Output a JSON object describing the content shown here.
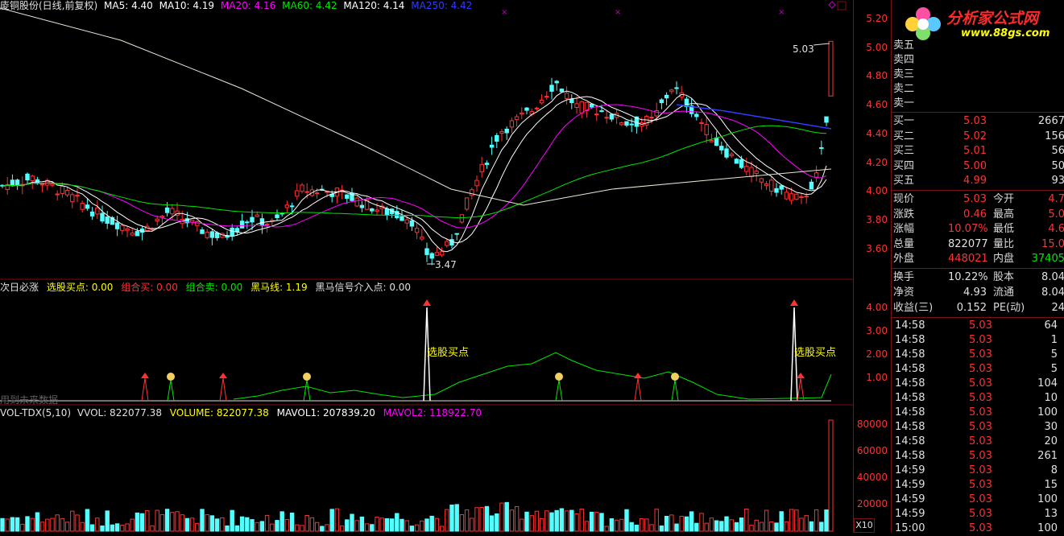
{
  "main_header": {
    "title": "庱铜股份(日线,前复权)",
    "ma5": "MA5: 4.40",
    "ma10": "MA10: 4.19",
    "ma20": "MA20: 4.16",
    "ma60": "MA60: 4.42",
    "ma120": "MA120: 4.14",
    "ma250": "MA250: 4.42"
  },
  "colors": {
    "up": "#ff3232",
    "down": "#54ffff",
    "ma5": "#ffffff",
    "ma10": "#ffff00",
    "ma20": "#ff00ff",
    "ma60": "#00e600",
    "ma250": "#2f3cff",
    "grid": "#7a1010"
  },
  "price_annotations": {
    "high_label": "5.03",
    "low_label": "3.47"
  },
  "price_axis": [
    "5.20",
    "5.00",
    "4.80",
    "4.60",
    "4.40",
    "4.20",
    "4.00",
    "3.80",
    "3.60"
  ],
  "indicator_header": {
    "name": "次日必涨",
    "buy_point": "选股买点: 0.00",
    "combo_buy": "组合买: 0.00",
    "combo_sell": "组合卖: 0.00",
    "black_horse": "黑马线: 1.19",
    "black_horse_signal": "黑马信号介入点: 0.00"
  },
  "indicator_labels": {
    "buy_point_1": "选股买点",
    "buy_point_2": "选股买点",
    "future_data": "用到未来数据"
  },
  "indicator_axis": [
    "4.00",
    "3.00",
    "2.00",
    "1.00"
  ],
  "volume_header": {
    "name": "VOL-TDX(5,10)",
    "vvol": "VVOL: 822077.38",
    "volume": "VOLUME: 822077.38",
    "mavol1": "MAVOL1: 207839.20",
    "mavol2": "MAVOL2: 118922.70"
  },
  "volume_axis": [
    "80000",
    "60000",
    "40000",
    "20000"
  ],
  "volume_unit": "X10",
  "logo": {
    "text": "分析家公式网",
    "url": "www.88gs.com"
  },
  "quote": {
    "sell": [
      {
        "label": "卖五"
      },
      {
        "label": "卖四"
      },
      {
        "label": "卖三"
      },
      {
        "label": "卖二"
      },
      {
        "label": "卖一"
      }
    ],
    "buy": [
      {
        "label": "买一",
        "price": "5.03",
        "vol": "2667"
      },
      {
        "label": "买二",
        "price": "5.02",
        "vol": "156"
      },
      {
        "label": "买三",
        "price": "5.01",
        "vol": "56"
      },
      {
        "label": "买四",
        "price": "5.00",
        "vol": "50"
      },
      {
        "label": "买五",
        "price": "4.99",
        "vol": "93"
      }
    ],
    "stats": [
      {
        "l1": "现价",
        "v1": "5.03",
        "l2": "今开",
        "v2": "4.7"
      },
      {
        "l1": "涨跌",
        "v1": "0.46",
        "l2": "最高",
        "v2": "5.0"
      },
      {
        "l1": "涨幅",
        "v1": "10.07%",
        "l2": "最低",
        "v2": "4.6"
      },
      {
        "l1": "总量",
        "v1": "822077",
        "l2": "量比",
        "v2": "15.0"
      },
      {
        "l1": "外盘",
        "v1": "448021",
        "l2": "内盘",
        "v2": "37405"
      }
    ],
    "stats2": [
      {
        "l1": "换手",
        "v1": "10.22%",
        "l2": "股本",
        "v2": "8.04"
      },
      {
        "l1": "净资",
        "v1": "4.93",
        "l2": "流通",
        "v2": "8.04"
      },
      {
        "l1": "收益(三)",
        "v1": "0.152",
        "l2": "PE(动)",
        "v2": "24"
      }
    ],
    "ticks": [
      {
        "time": "14:58",
        "price": "5.03",
        "vol": "64"
      },
      {
        "time": "14:58",
        "price": "5.03",
        "vol": "1"
      },
      {
        "time": "14:58",
        "price": "5.03",
        "vol": "5"
      },
      {
        "time": "14:58",
        "price": "5.03",
        "vol": "5"
      },
      {
        "time": "14:58",
        "price": "5.03",
        "vol": "104"
      },
      {
        "time": "14:58",
        "price": "5.03",
        "vol": "10"
      },
      {
        "time": "14:58",
        "price": "5.03",
        "vol": "100"
      },
      {
        "time": "14:58",
        "price": "5.03",
        "vol": "30"
      },
      {
        "time": "14:58",
        "price": "5.03",
        "vol": "20"
      },
      {
        "time": "14:58",
        "price": "5.03",
        "vol": "261"
      },
      {
        "time": "14:59",
        "price": "5.03",
        "vol": "8"
      },
      {
        "time": "14:59",
        "price": "5.03",
        "vol": "15"
      },
      {
        "time": "14:59",
        "price": "5.03",
        "vol": "100"
      },
      {
        "time": "14:59",
        "price": "5.03",
        "vol": "13"
      },
      {
        "time": "15:00",
        "price": "5.03",
        "vol": "100"
      }
    ]
  }
}
